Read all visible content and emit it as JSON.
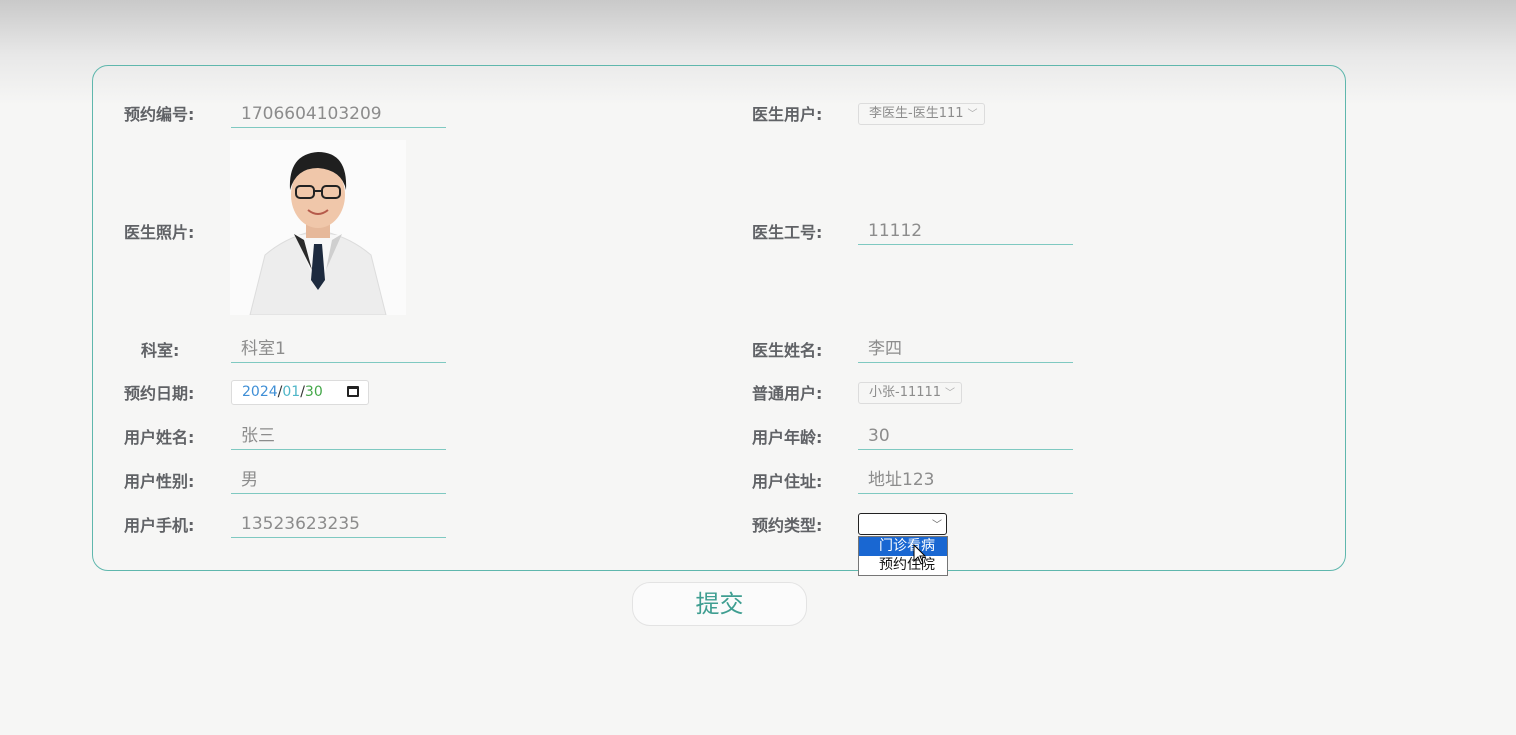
{
  "form": {
    "left": {
      "appointment_no": {
        "label": "预约编号:",
        "value": "1706604103209"
      },
      "doctor_photo": {
        "label": "医生照片:"
      },
      "department": {
        "label": "科室:",
        "value": "科室1"
      },
      "appointment_date": {
        "label": "预约日期:",
        "year": "2024",
        "month": "01",
        "day": "30",
        "sep": "/"
      },
      "user_name": {
        "label": "用户姓名:",
        "value": "张三"
      },
      "user_gender": {
        "label": "用户性别:",
        "value": "男"
      },
      "user_phone": {
        "label": "用户手机:",
        "value": "13523623235"
      }
    },
    "right": {
      "doctor_user": {
        "label": "医生用户:",
        "value": "李医生-医生111"
      },
      "doctor_id": {
        "label": "医生工号:",
        "value": "11112"
      },
      "doctor_name": {
        "label": "医生姓名:",
        "value": "李四"
      },
      "normal_user": {
        "label": "普通用户:",
        "value": "小张-11111"
      },
      "user_age": {
        "label": "用户年龄:",
        "value": "30"
      },
      "user_address": {
        "label": "用户住址:",
        "value": "地址123"
      },
      "appointment_type": {
        "label": "预约类型:",
        "value": "",
        "options": [
          "门诊看病",
          "预约住院"
        ],
        "highlighted": "门诊看病"
      }
    }
  },
  "submit_label": "提交",
  "colors": {
    "accent": "#5fb7ad",
    "submit_text": "#3f9e91",
    "highlight": "#1967d2"
  },
  "icons": {
    "calendar": "calendar-icon",
    "chevron": "chevron-down-icon",
    "cursor": "pointer-cursor-icon"
  }
}
